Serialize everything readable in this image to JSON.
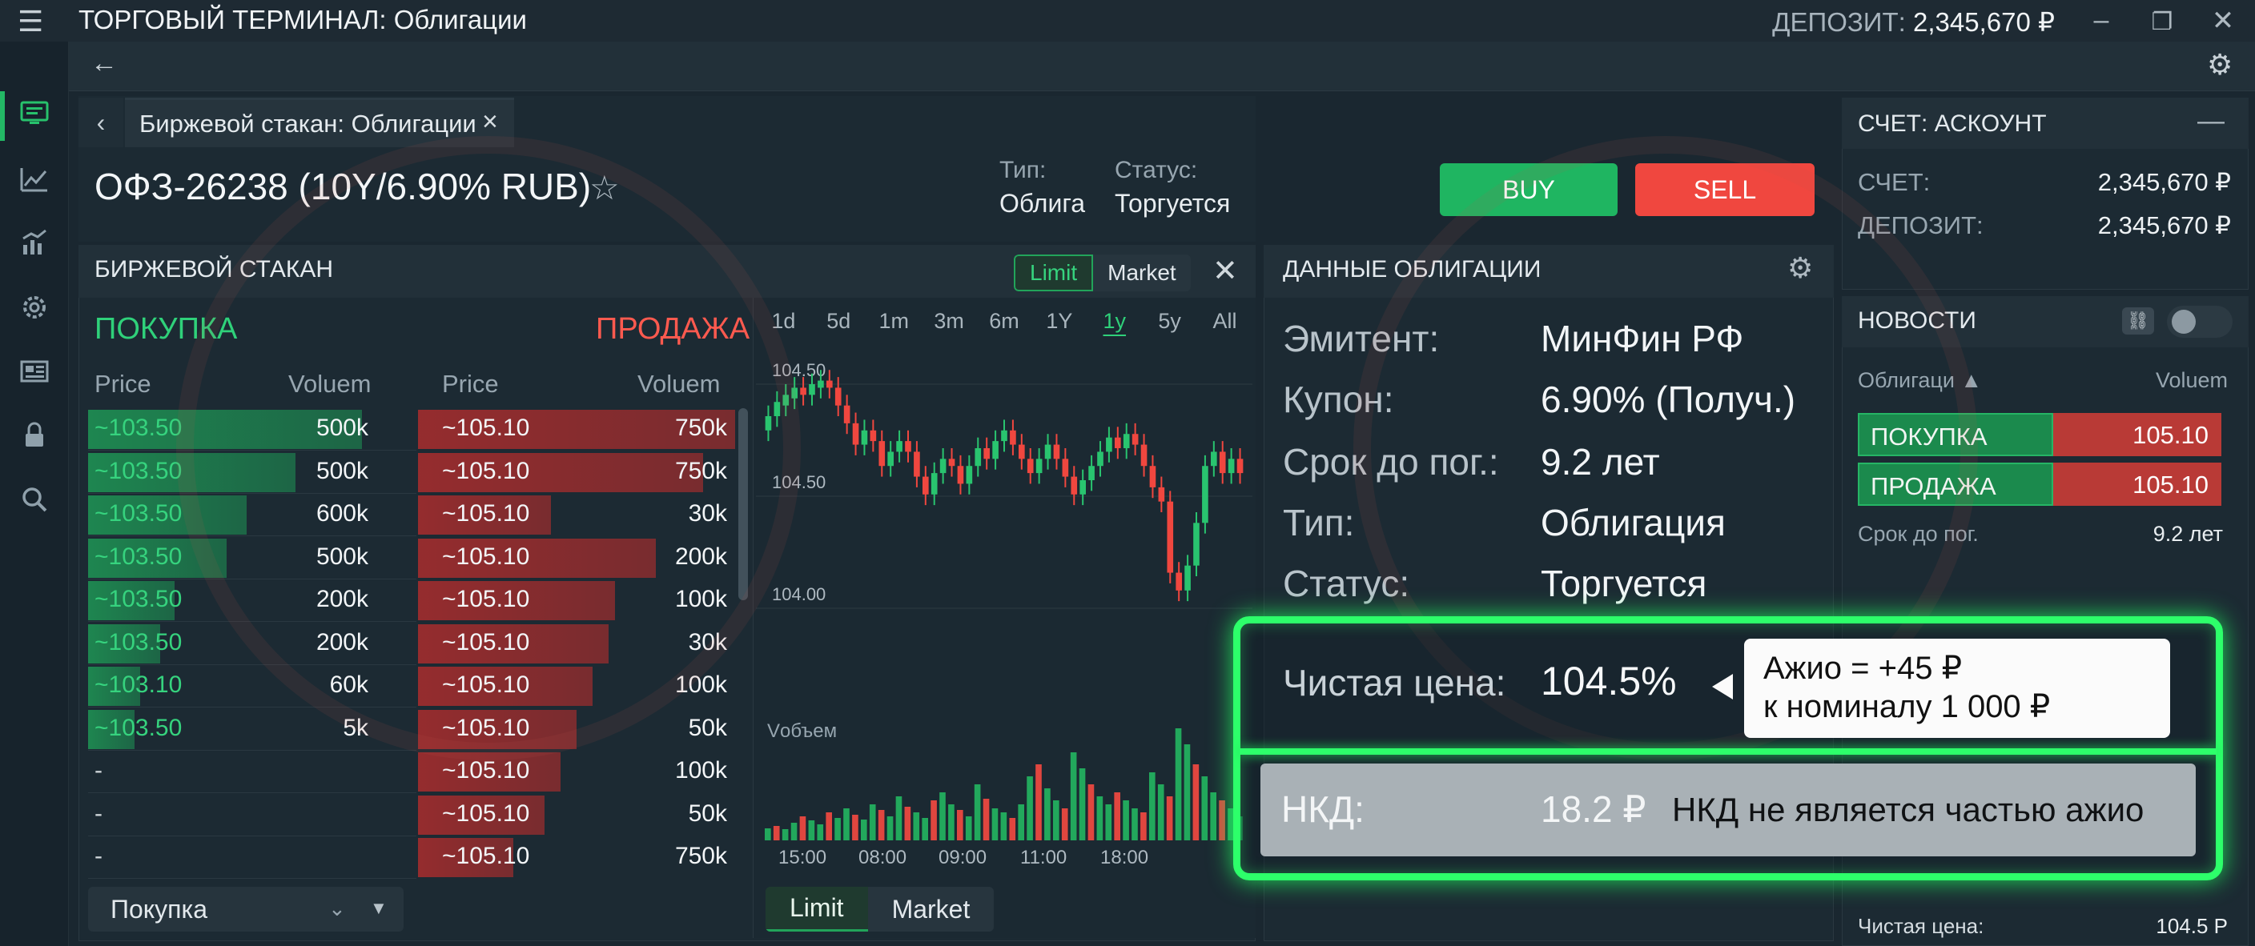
{
  "window": {
    "title": "ТОРГОВЫЙ ТЕРМИНАЛ: Облигации",
    "deposit_label": "ДЕПОЗИТ:",
    "deposit_value": "2,345,670 ₽",
    "menu_icon": "hamburger-icon",
    "minimize_icon": "minimize-icon",
    "restore_icon": "restore-icon",
    "close_icon": "close-icon"
  },
  "tab": {
    "label": "Биржевой стакан: Облигации",
    "close": "×"
  },
  "instrument": {
    "name": "ОФЗ-26238 (10Y/6.90% RUB)",
    "star": "☆",
    "type_label": "Тип:",
    "type_value": "Облига",
    "status_label": "Статус:",
    "status_value": "Торгуется",
    "buy_label": "BUY",
    "sell_label": "SELL"
  },
  "orderbook": {
    "title": "БИРЖЕВОЙ СТАКАН",
    "limit": "Limit",
    "market": "Market",
    "buy_header": "ПОКУПКА",
    "sell_header": "ПРОДАЖА",
    "col_price": "Price",
    "col_volume": "Voluem",
    "bids": [
      {
        "price": "~103.50",
        "volume": "500k",
        "fill": 0.95
      },
      {
        "price": "~103.50",
        "volume": "500k",
        "fill": 0.72
      },
      {
        "price": "~103.50",
        "volume": "600k",
        "fill": 0.55
      },
      {
        "price": "~103.50",
        "volume": "500k",
        "fill": 0.48
      },
      {
        "price": "~103.50",
        "volume": "200k",
        "fill": 0.3
      },
      {
        "price": "~103.50",
        "volume": "200k",
        "fill": 0.25
      },
      {
        "price": "~103.10",
        "volume": "60k",
        "fill": 0.18
      },
      {
        "price": "~103.50",
        "volume": "5k",
        "fill": 0.16
      },
      {
        "price": "-",
        "volume": "",
        "fill": 0
      },
      {
        "price": "-",
        "volume": "",
        "fill": 0
      },
      {
        "price": "-",
        "volume": "",
        "fill": 0
      }
    ],
    "asks": [
      {
        "price": "~105.10",
        "volume": "750k",
        "fill": 1.0
      },
      {
        "price": "~105.10",
        "volume": "750k",
        "fill": 0.9
      },
      {
        "price": "~105.10",
        "volume": "30k",
        "fill": 0.42
      },
      {
        "price": "~105.10",
        "volume": "200k",
        "fill": 0.75
      },
      {
        "price": "~105.10",
        "volume": "100k",
        "fill": 0.62
      },
      {
        "price": "~105.10",
        "volume": "30k",
        "fill": 0.6
      },
      {
        "price": "~105.10",
        "volume": "100k",
        "fill": 0.55
      },
      {
        "price": "~105.10",
        "volume": "50k",
        "fill": 0.5
      },
      {
        "price": "~105.10",
        "volume": "100k",
        "fill": 0.45
      },
      {
        "price": "~105.10",
        "volume": "50k",
        "fill": 0.4
      },
      {
        "price": "~105.10",
        "volume": "750k",
        "fill": 0.3
      }
    ],
    "side_select": "Покупка"
  },
  "chart": {
    "periods": [
      "1d",
      "5d",
      "1m",
      "3m",
      "6m",
      "1Y",
      "1y",
      "5y",
      "All"
    ],
    "active_period": "1y",
    "volume_label": "Vобъем",
    "limit": "Limit",
    "market": "Market"
  },
  "chart_data": {
    "type": "candlestick",
    "y_ticks": [
      "104.50",
      "104.50",
      "104.00"
    ],
    "x_ticks": [
      "15:00",
      "08:00",
      "09:00",
      "11:00",
      "18:00"
    ],
    "ylim": [
      103.8,
      104.7
    ],
    "candles": [
      [
        104.48,
        104.52
      ],
      [
        104.52,
        104.56
      ],
      [
        104.55,
        104.58
      ],
      [
        104.57,
        104.6
      ],
      [
        104.6,
        104.58
      ],
      [
        104.58,
        104.61
      ],
      [
        104.6,
        104.62
      ],
      [
        104.62,
        104.6
      ],
      [
        104.6,
        104.55
      ],
      [
        104.55,
        104.5
      ],
      [
        104.5,
        104.44
      ],
      [
        104.44,
        104.48
      ],
      [
        104.48,
        104.45
      ],
      [
        104.45,
        104.38
      ],
      [
        104.38,
        104.42
      ],
      [
        104.42,
        104.45
      ],
      [
        104.45,
        104.42
      ],
      [
        104.42,
        104.35
      ],
      [
        104.35,
        104.3
      ],
      [
        104.3,
        104.36
      ],
      [
        104.36,
        104.4
      ],
      [
        104.4,
        104.38
      ],
      [
        104.38,
        104.33
      ],
      [
        104.33,
        104.38
      ],
      [
        104.38,
        104.43
      ],
      [
        104.43,
        104.4
      ],
      [
        104.4,
        104.45
      ],
      [
        104.45,
        104.48
      ],
      [
        104.48,
        104.44
      ],
      [
        104.44,
        104.4
      ],
      [
        104.4,
        104.36
      ],
      [
        104.36,
        104.4
      ],
      [
        104.4,
        104.44
      ],
      [
        104.44,
        104.4
      ],
      [
        104.4,
        104.35
      ],
      [
        104.35,
        104.3
      ],
      [
        104.3,
        104.34
      ],
      [
        104.34,
        104.38
      ],
      [
        104.38,
        104.42
      ],
      [
        104.42,
        104.46
      ],
      [
        104.46,
        104.43
      ],
      [
        104.43,
        104.47
      ],
      [
        104.47,
        104.44
      ],
      [
        104.44,
        104.38
      ],
      [
        104.38,
        104.32
      ],
      [
        104.32,
        104.28
      ],
      [
        104.28,
        104.08
      ],
      [
        104.08,
        104.03
      ],
      [
        104.03,
        104.1
      ],
      [
        104.1,
        104.22
      ],
      [
        104.22,
        104.38
      ],
      [
        104.38,
        104.42
      ],
      [
        104.42,
        104.36
      ],
      [
        104.36,
        104.4
      ],
      [
        104.4,
        104.36
      ]
    ],
    "volumes": [
      15,
      18,
      14,
      22,
      30,
      25,
      20,
      35,
      28,
      40,
      32,
      26,
      45,
      38,
      30,
      55,
      42,
      35,
      28,
      50,
      60,
      45,
      38,
      30,
      70,
      52,
      40,
      35,
      28,
      45,
      80,
      95,
      65,
      50,
      40,
      110,
      90,
      70,
      55,
      45,
      60,
      50,
      40,
      35,
      85,
      70,
      55,
      140,
      120,
      95,
      80,
      60,
      50,
      40,
      30
    ]
  },
  "bond": {
    "title": "ДАННЫЕ ОБЛИГАЦИИ",
    "issuer_label": "Эмитент:",
    "issuer_value": "МинФин РФ",
    "coupon_label": "Купон:",
    "coupon_value": "6.90% (Получ.)",
    "maturity_label": "Срок до пог.:",
    "maturity_value": "9.2 лет",
    "type_label": "Тип:",
    "type_value": "Облигация",
    "status_label": "Статус:",
    "status_value": "Торгуется",
    "clean_label": "Чистая цена:",
    "clean_value": "104.5%",
    "premium_line1": "Ажио = +45 ₽",
    "premium_line2": "к номиналу 1 000 ₽",
    "aci_label": "НКД:",
    "aci_value": "18.2 ₽",
    "aci_note": "НКД не является частью ажио"
  },
  "account": {
    "title": "СЧЕТ: АСКОУНТ",
    "collapse": "—",
    "account_label": "СЧЕТ:",
    "account_value": "2,345,670 ₽",
    "deposit_label": "ДЕПОЗИТ:",
    "deposit_value": "2,345,670 ₽"
  },
  "news": {
    "title": "НОВОСТИ",
    "col_bonds": "Облигаци ▲",
    "col_volume": "Voluem",
    "buy_label": "ПОКУПКА",
    "buy_value": "105.10",
    "sell_label": "ПРОДАЖА",
    "sell_value": "105.10",
    "maturity_label": "Срок до пог.",
    "maturity_value": "9.2 лет",
    "clean_label": "Чистая цена:",
    "clean_value": "104.5 Р"
  },
  "colors": {
    "accent_green": "#25c06a",
    "accent_red": "#f0473f",
    "highlight": "#2dff6a"
  }
}
